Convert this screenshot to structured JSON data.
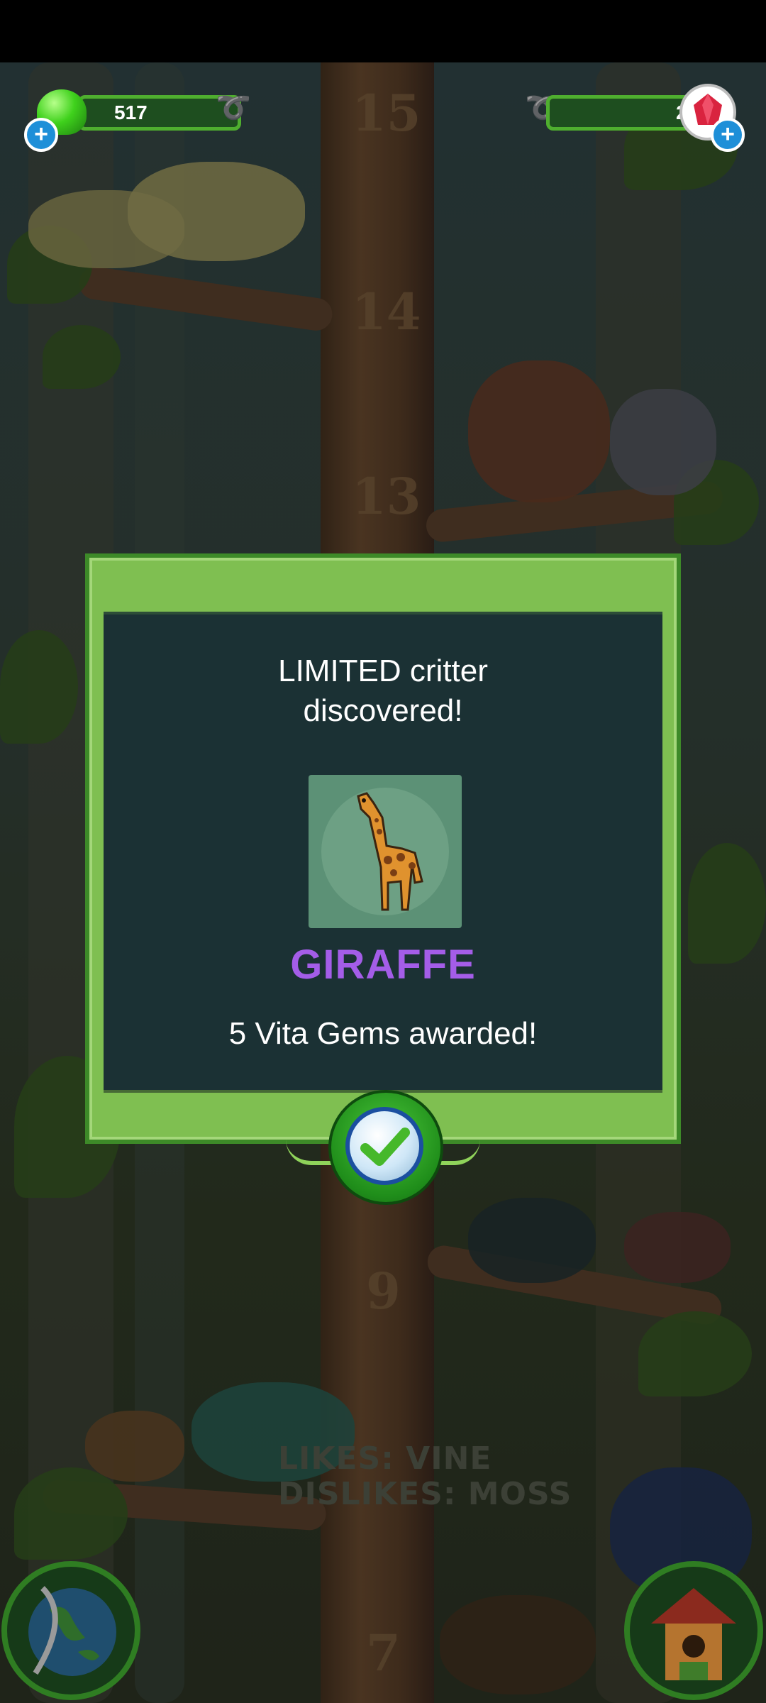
{
  "hud": {
    "left_value": "517",
    "right_value": "2",
    "left_icon": "green-jelly-icon",
    "right_icon": "red-gem-icon",
    "add_icon": "plus-icon"
  },
  "scene": {
    "level_numbers": [
      "15",
      "14",
      "13",
      "9",
      "7"
    ],
    "hint_likes": "LIKES: VINE",
    "hint_dislikes": "DISLIKES: MOSS"
  },
  "dialog": {
    "title_line1": "LIMITED critter",
    "title_line2": "discovered!",
    "critter_name": "GIRAFFE",
    "reward_text": "5 Vita Gems awarded!",
    "confirm_icon": "checkmark-icon"
  },
  "colors": {
    "dialog_frame": "#7fbf51",
    "dialog_panel": "#1b3134",
    "critter_name": "#a45de8",
    "hud_accent": "#4fae2f"
  },
  "corner_buttons": {
    "left_icon": "globe-icon",
    "right_icon": "birdhouse-icon"
  }
}
